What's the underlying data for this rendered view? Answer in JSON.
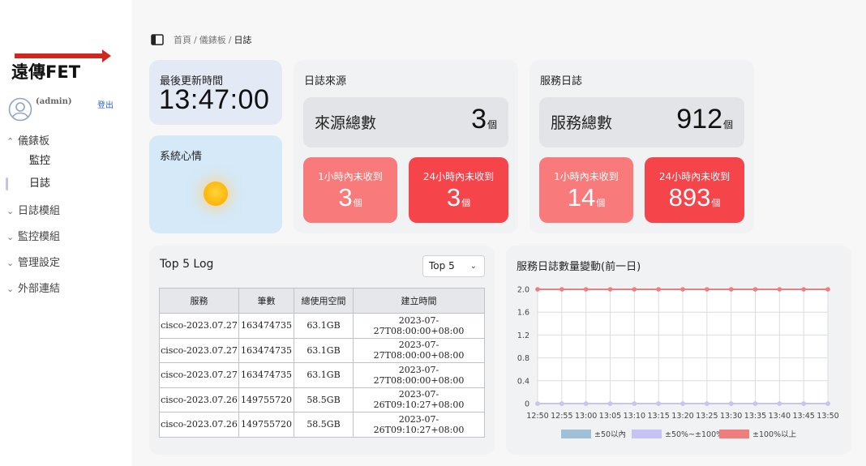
{
  "brand": {
    "logo_text": "遠傳FET",
    "red": "#d0281e"
  },
  "user": {
    "name": "(admin)",
    "logout_label": "登出"
  },
  "nav": {
    "dashboard": {
      "label": "儀錶板",
      "items": [
        {
          "label": "監控"
        },
        {
          "label": "日誌"
        }
      ]
    },
    "groups": [
      {
        "label": "日誌模組"
      },
      {
        "label": "監控模組"
      },
      {
        "label": "管理設定"
      },
      {
        "label": "外部連結"
      }
    ]
  },
  "breadcrumb": {
    "items": [
      "首頁",
      "儀錶板",
      "日誌"
    ]
  },
  "last_update": {
    "label": "最後更新時間",
    "value": "13:47:00"
  },
  "mood": {
    "label": "系統心情"
  },
  "log_source": {
    "title": "日誌來源",
    "total_label": "來源總數",
    "total_value": "3",
    "unit": "個",
    "alert_1h_label": "1小時內未收到",
    "alert_1h_value": "3",
    "alert_24h_label": "24小時內未收到",
    "alert_24h_value": "3"
  },
  "service_log": {
    "title": "服務日誌",
    "total_label": "服務總數",
    "total_value": "912",
    "unit": "個",
    "alert_1h_label": "1小時內未收到",
    "alert_1h_value": "14",
    "alert_24h_label": "24小時內未收到",
    "alert_24h_value": "893"
  },
  "top_log": {
    "title": "Top 5 Log",
    "select_value": "Top 5",
    "columns": [
      "服務",
      "筆數",
      "總使用空間",
      "建立時間"
    ],
    "rows": [
      [
        "cisco-2023.07.27",
        "163474735",
        "63.1GB",
        "2023-07-27T08:00:00+08:00"
      ],
      [
        "cisco-2023.07.27",
        "163474735",
        "63.1GB",
        "2023-07-27T08:00:00+08:00"
      ],
      [
        "cisco-2023.07.27",
        "163474735",
        "63.1GB",
        "2023-07-27T08:00:00+08:00"
      ],
      [
        "cisco-2023.07.26",
        "149755720",
        "58.5GB",
        "2023-07-26T09:10:27+08:00"
      ],
      [
        "cisco-2023.07.26",
        "149755720",
        "58.5GB",
        "2023-07-26T09:10:27+08:00"
      ]
    ]
  },
  "chart_data": {
    "type": "line",
    "title": "服務日誌數量變動(前一日)",
    "x": [
      "12:50",
      "12:55",
      "13:00",
      "13:05",
      "13:10",
      "13:15",
      "13:20",
      "13:25",
      "13:30",
      "13:35",
      "13:40",
      "13:45",
      "13:50"
    ],
    "ylim": [
      0,
      2.0
    ],
    "yticks": [
      "2.0",
      "1.6",
      "1.2",
      "0.8",
      "0.4",
      "0"
    ],
    "grid": true,
    "legend_position": "bottom",
    "series": [
      {
        "name": "±50以內",
        "color": "#9fc0d8",
        "values": [
          0,
          0,
          0,
          0,
          0,
          0,
          0,
          0,
          0,
          0,
          0,
          0,
          0
        ]
      },
      {
        "name": "±50%~±100%",
        "color": "#c7c3f3",
        "values": [
          0,
          0,
          0,
          0,
          0,
          0,
          0,
          0,
          0,
          0,
          0,
          0,
          0
        ]
      },
      {
        "name": "±100%以上",
        "color": "#f07d7d",
        "values": [
          2,
          2,
          2,
          2,
          2,
          2,
          2,
          2,
          2,
          2,
          2,
          2,
          2
        ]
      }
    ]
  }
}
